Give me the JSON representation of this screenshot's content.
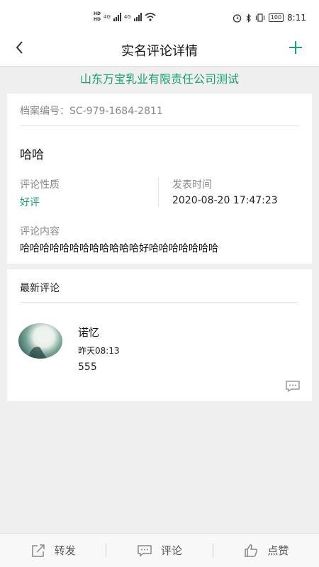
{
  "status": {
    "net_left": "HD",
    "net_mid": "4G",
    "net_mid2": "4G",
    "battery": "100",
    "time": "8:11"
  },
  "nav": {
    "title": "实名评论详情",
    "back_icon": "chevron-left-icon",
    "add_icon": "plus-icon"
  },
  "company": "山东万宝乳业有限责任公司测试",
  "detail": {
    "archive_label": "档案编号：",
    "archive_no": "SC-979-1684-2811",
    "name": "哈哈",
    "nature_label": "评论性质",
    "nature_value": "好评",
    "time_label": "发表时间",
    "time_value": "2020-08-20 17:47:23",
    "content_label": "评论内容",
    "content_value": "哈哈哈哈哈哈哈哈哈哈哈哈好哈哈哈哈哈哈哈"
  },
  "latest": {
    "title": "最新评论",
    "comments": [
      {
        "user": "诺忆",
        "time": "昨天08:13",
        "text": "555"
      }
    ]
  },
  "bottom": {
    "share": "转发",
    "comment": "评论",
    "like": "点赞"
  },
  "colors": {
    "accent": "#1aa36f"
  }
}
